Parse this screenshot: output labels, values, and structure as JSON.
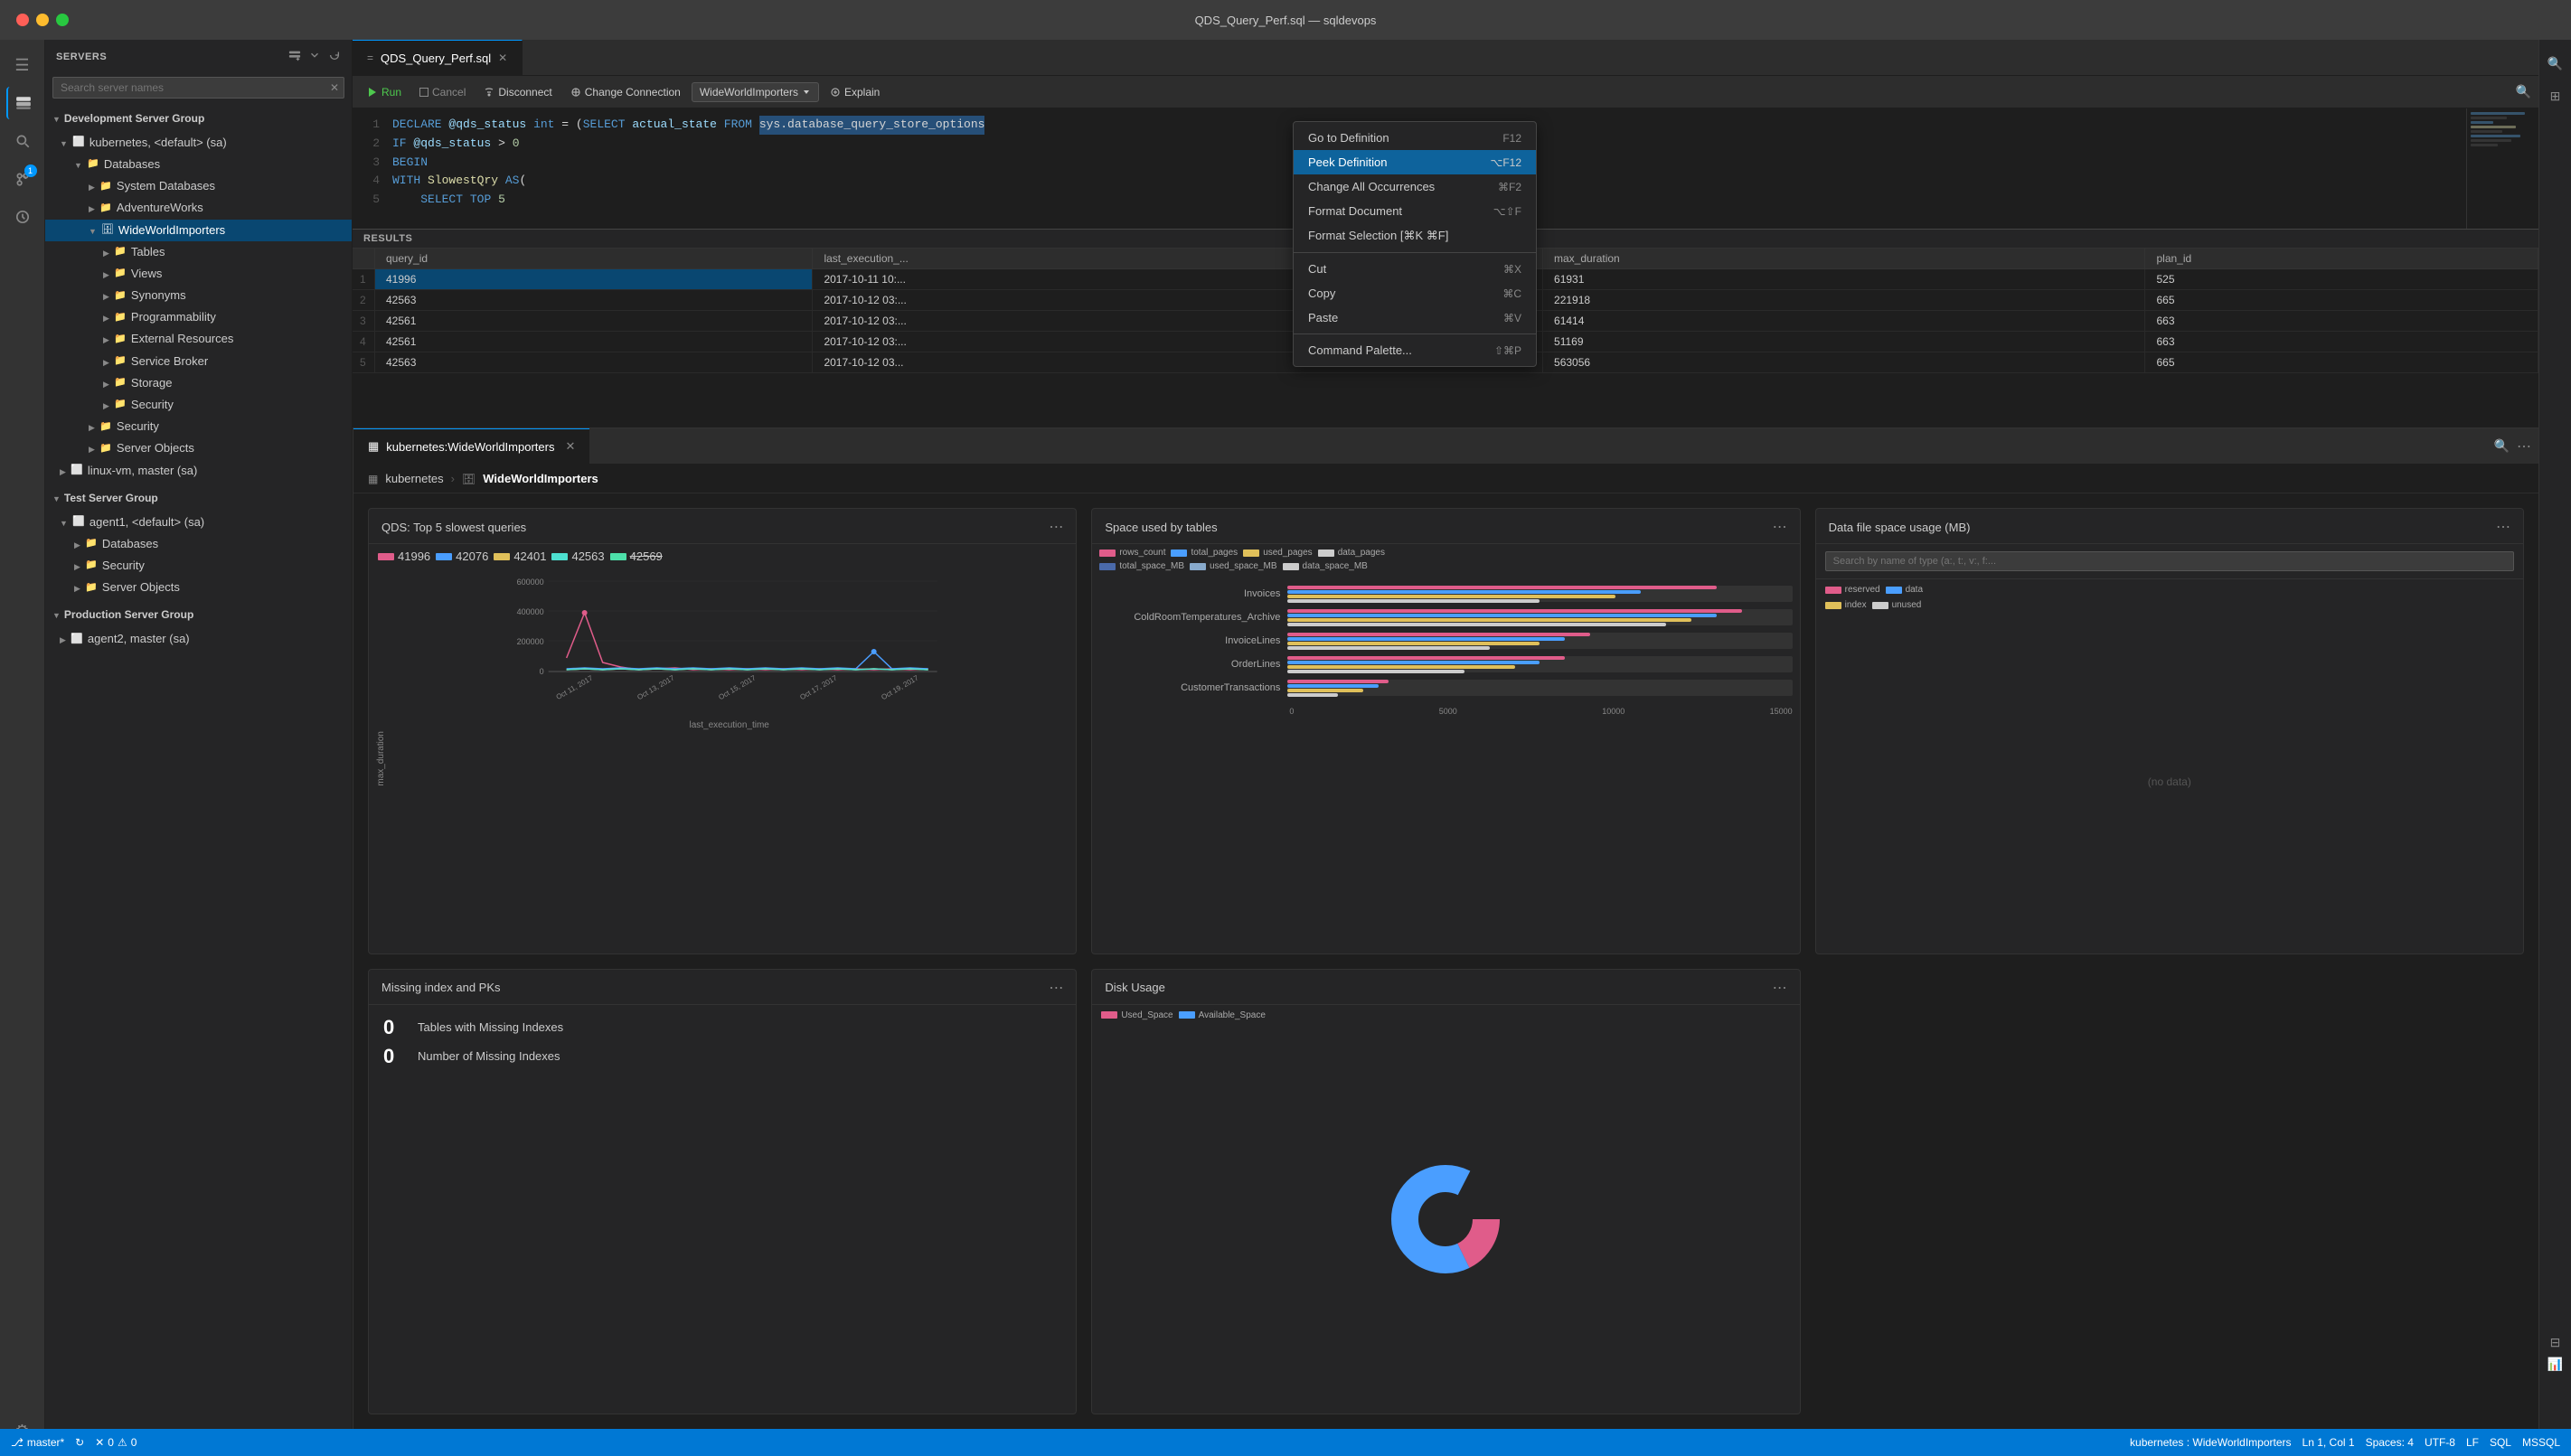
{
  "titlebar": {
    "title": "QDS_Query_Perf.sql — sqldevops"
  },
  "sidebar": {
    "header": "SERVERS",
    "search_placeholder": "Search server names",
    "groups": [
      {
        "name": "Development Server Group",
        "expanded": true,
        "servers": [
          {
            "name": "kubernetes, <default> (sa)",
            "expanded": true,
            "icon": "server",
            "children": [
              {
                "name": "Databases",
                "expanded": true,
                "icon": "folder",
                "children": [
                  {
                    "name": "System Databases",
                    "icon": "folder",
                    "expanded": false
                  },
                  {
                    "name": "AdventureWorks",
                    "icon": "folder",
                    "expanded": false
                  },
                  {
                    "name": "WideWorldImporters",
                    "icon": "db",
                    "expanded": true,
                    "selected": true,
                    "children": [
                      {
                        "name": "Tables",
                        "icon": "folder"
                      },
                      {
                        "name": "Views",
                        "icon": "folder"
                      },
                      {
                        "name": "Synonyms",
                        "icon": "folder"
                      },
                      {
                        "name": "Programmability",
                        "icon": "folder"
                      },
                      {
                        "name": "External Resources",
                        "icon": "folder"
                      },
                      {
                        "name": "Service Broker",
                        "icon": "folder"
                      },
                      {
                        "name": "Storage",
                        "icon": "folder"
                      },
                      {
                        "name": "Security",
                        "icon": "folder"
                      },
                      {
                        "name": "Security",
                        "icon": "folder"
                      },
                      {
                        "name": "Server Objects",
                        "icon": "folder"
                      }
                    ]
                  }
                ]
              }
            ]
          },
          {
            "name": "linux-vm, master (sa)",
            "icon": "server",
            "expanded": false
          }
        ]
      },
      {
        "name": "Test Server Group",
        "expanded": true,
        "servers": [
          {
            "name": "agent1, <default> (sa)",
            "expanded": true,
            "icon": "server",
            "children": [
              {
                "name": "Databases",
                "icon": "folder",
                "expanded": false
              },
              {
                "name": "Security",
                "icon": "folder",
                "expanded": false
              },
              {
                "name": "Server Objects",
                "icon": "folder",
                "expanded": false
              }
            ]
          }
        ]
      },
      {
        "name": "Production Server Group",
        "expanded": true,
        "servers": [
          {
            "name": "agent2, master (sa)",
            "icon": "server",
            "expanded": false
          }
        ]
      }
    ]
  },
  "editor": {
    "tabs": [
      {
        "name": "QDS_Query_Perf.sql",
        "active": true,
        "icon": "sql"
      },
      {
        "name": "kubernetes:WideWorldImporters",
        "active": false,
        "icon": "dashboard"
      }
    ],
    "toolbar": {
      "run_label": "Run",
      "cancel_label": "Cancel",
      "disconnect_label": "Disconnect",
      "change_conn_label": "Change Connection",
      "db_selector": "WideWorldImporters",
      "explain_label": "Explain"
    },
    "code_lines": [
      {
        "num": "1",
        "content": "DECLARE @qds_status int = (SELECT actual_state FROM sys.database_query_store_options"
      },
      {
        "num": "2",
        "content": "IF @qds_status > 0"
      },
      {
        "num": "3",
        "content": "BEGIN"
      },
      {
        "num": "4",
        "content": "WITH SlowestQry AS("
      },
      {
        "num": "5",
        "content": "    SELECT TOP 5"
      }
    ]
  },
  "context_menu": {
    "items": [
      {
        "label": "Go to Definition",
        "shortcut": "F12",
        "highlighted": false
      },
      {
        "label": "Peek Definition",
        "shortcut": "⌥F12",
        "highlighted": true
      },
      {
        "label": "Change All Occurrences",
        "shortcut": "⌘F2",
        "highlighted": false
      },
      {
        "label": "Format Document",
        "shortcut": "⌥⇧F",
        "highlighted": false
      },
      {
        "label": "Format Selection [⌘K ⌘F]",
        "shortcut": "",
        "highlighted": false
      },
      {
        "separator": true
      },
      {
        "label": "Cut",
        "shortcut": "⌘X",
        "highlighted": false
      },
      {
        "label": "Copy",
        "shortcut": "⌘C",
        "highlighted": false
      },
      {
        "label": "Paste",
        "shortcut": "⌘V",
        "highlighted": false
      },
      {
        "separator": true
      },
      {
        "label": "Command Palette...",
        "shortcut": "⇧⌘P",
        "highlighted": false
      }
    ]
  },
  "results": {
    "header": "RESULTS",
    "columns": [
      "query_id",
      "last_execution_...",
      "max_duration",
      "plan_id"
    ],
    "rows": [
      {
        "num": "1",
        "query_id": "41996",
        "last_exec": "2017-10-11 10:...",
        "max_dur": "61931",
        "plan_id": "525",
        "highlight": true
      },
      {
        "num": "2",
        "query_id": "42563",
        "last_exec": "2017-10-12 03:...",
        "max_dur": "221918",
        "plan_id": "665"
      },
      {
        "num": "3",
        "query_id": "42561",
        "last_exec": "2017-10-12 03:...",
        "max_dur": "61414",
        "plan_id": "663"
      },
      {
        "num": "4",
        "query_id": "42561",
        "last_exec": "2017-10-12 03:...",
        "max_dur": "51169",
        "plan_id": "663"
      },
      {
        "num": "5",
        "query_id": "42563",
        "last_exec": "2017-10-12 03...",
        "max_dur": "563056",
        "plan_id": "665"
      }
    ]
  },
  "dashboard": {
    "breadcrumb": {
      "server": "kubernetes",
      "db": "WideWorldImporters"
    },
    "cards": {
      "qds": {
        "title": "QDS: Top 5 slowest queries",
        "legend": [
          {
            "color": "#e05c8a",
            "label": "41996"
          },
          {
            "color": "#4a9eff",
            "label": "42076"
          },
          {
            "color": "#e0c05a",
            "label": "42401"
          },
          {
            "color": "#4de0d0",
            "label": "42563"
          },
          {
            "color": "#4de0aa",
            "label": "42569"
          }
        ],
        "x_axis_label": "last_execution_time",
        "y_axis_label": "max_duration",
        "y_ticks": [
          "600000",
          "400000",
          "200000",
          "0"
        ],
        "x_ticks": [
          "Oct 11, 2017",
          "Oct 13, 2017",
          "Oct 15, 2017",
          "Oct 17, 2017",
          "Oct 19, 2017"
        ]
      },
      "space": {
        "title": "Space used by tables",
        "legend": [
          {
            "color": "#e05c8a",
            "label": "rows_count"
          },
          {
            "color": "#4a9eff",
            "label": "total_pages"
          },
          {
            "color": "#e0c05a",
            "label": "used_pages"
          },
          {
            "color": "#ccc",
            "label": "data_pages"
          },
          {
            "color": "#4a6aaa",
            "label": "total_space_MB"
          },
          {
            "color": "#88aacc",
            "label": "used_space_MB"
          },
          {
            "color": "#ccc",
            "label": "data_space_MB"
          }
        ],
        "rows": [
          {
            "label": "Invoices",
            "pink": 85,
            "blue": 70,
            "yellow": 65,
            "white": 50
          },
          {
            "label": "ColdRoomTemperatures_Archive",
            "pink": 90,
            "blue": 80,
            "yellow": 75,
            "white": 70
          },
          {
            "label": "InvoiceLines",
            "pink": 60,
            "blue": 55,
            "yellow": 50,
            "white": 40
          },
          {
            "label": "OrderLines",
            "pink": 55,
            "blue": 50,
            "yellow": 45,
            "white": 35
          },
          {
            "label": "CustomerTransactions",
            "pink": 20,
            "blue": 18,
            "yellow": 15,
            "white": 10
          }
        ],
        "x_ticks": [
          "0",
          "5000",
          "10000",
          "15000"
        ]
      },
      "missing": {
        "title": "Missing index and PKs",
        "stats": [
          {
            "num": "0",
            "label": "Tables with Missing Indexes"
          },
          {
            "num": "0",
            "label": "Number of Missing Indexes"
          }
        ]
      },
      "disk": {
        "title": "Disk Usage",
        "legend": [
          {
            "color": "#e05c8a",
            "label": "Used_Space"
          },
          {
            "color": "#4a9eff",
            "label": "Available_Space"
          }
        ]
      },
      "datafile": {
        "title": "Data file space usage (MB)",
        "search_placeholder": "Search by name of type (a:, t:, v:, f:...",
        "legend": [
          {
            "color": "#e05c8a",
            "label": "reserved"
          },
          {
            "color": "#4a9eff",
            "label": "data"
          },
          {
            "color": "#e0c05a",
            "label": "index"
          },
          {
            "color": "#ccc",
            "label": "unused"
          }
        ]
      }
    }
  },
  "status_bar": {
    "branch": "master*",
    "sync_icon": "↻",
    "errors": "0",
    "warnings": "0",
    "connection": "kubernetes : WideWorldImporters",
    "position": "Ln 1, Col 1",
    "spaces": "Spaces: 4",
    "encoding": "UTF-8",
    "line_ending": "LF",
    "language": "SQL",
    "dialect": "MSSQL"
  }
}
